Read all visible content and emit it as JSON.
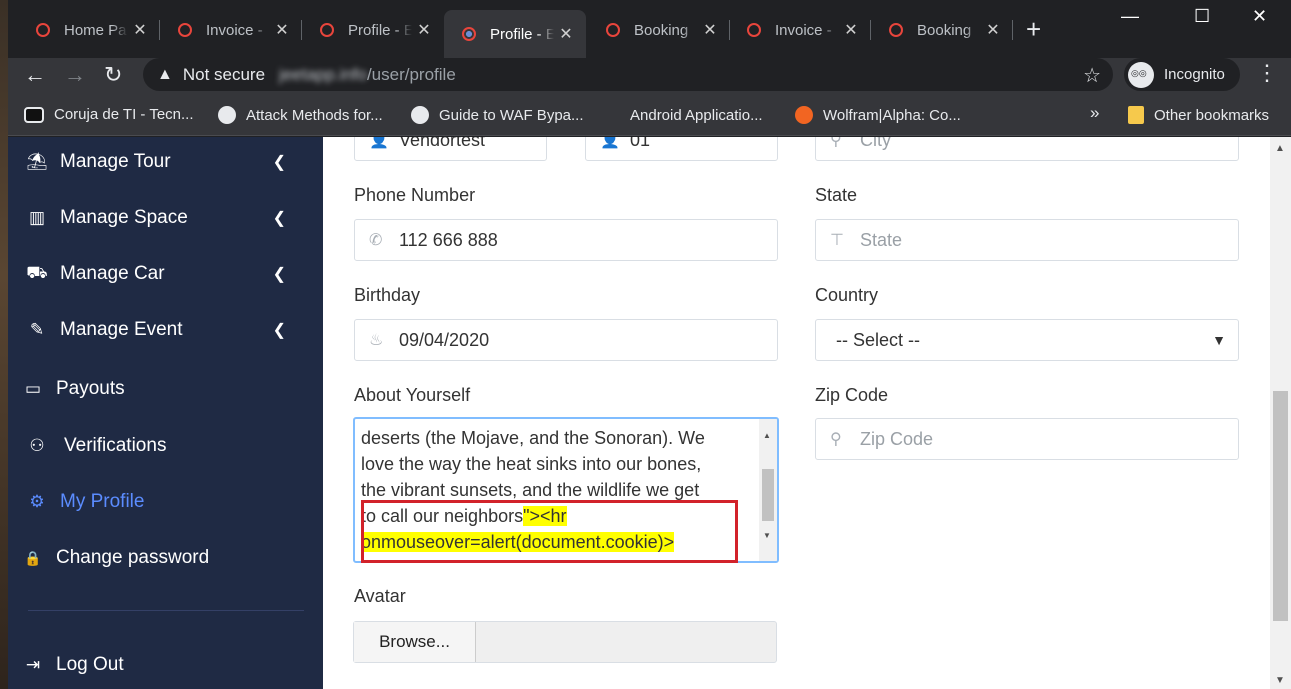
{
  "browser": {
    "tabs": [
      {
        "title": "Home Pa",
        "active": false
      },
      {
        "title": "Invoice -",
        "active": false
      },
      {
        "title": "Profile - E",
        "active": false
      },
      {
        "title": "Profile - E",
        "active": true
      },
      {
        "title": "Booking",
        "active": false
      },
      {
        "title": "Invoice -",
        "active": false
      },
      {
        "title": "Booking",
        "active": false
      }
    ],
    "new_tab": "+",
    "window_controls": {
      "minimize": "—",
      "maximize": "☐",
      "close": "✕"
    },
    "nav": {
      "back": "←",
      "forward": "→",
      "reload": "↻"
    },
    "address": {
      "security_label": "Not secure",
      "host": "jeetapp.info",
      "path": "/user/profile"
    },
    "incognito_label": "Incognito",
    "bookmarks": [
      {
        "label": "Coruja de TI - Tecn...",
        "icon": "owl-icon",
        "color": "#e8eaed"
      },
      {
        "label": "Attack Methods for...",
        "icon": "globe-icon",
        "color": "#e8eaed"
      },
      {
        "label": "Guide to WAF Bypa...",
        "icon": "globe-icon",
        "color": "#e8eaed"
      },
      {
        "label": "Android Applicatio...",
        "icon": "blank-icon",
        "color": "#35363a"
      },
      {
        "label": "Wolfram|Alpha: Co...",
        "icon": "wolfram-icon",
        "color": "#f26522"
      }
    ],
    "bookmarks_more": "»",
    "other_bookmarks": "Other bookmarks"
  },
  "sidebar": {
    "items": [
      {
        "label": "Manage Tour",
        "icon": "palm-tree-icon",
        "glyph": "⛱",
        "has_chevron": true,
        "active": false
      },
      {
        "label": "Manage Space",
        "icon": "building-icon",
        "glyph": "▥",
        "has_chevron": true,
        "active": false
      },
      {
        "label": "Manage Car",
        "icon": "car-icon",
        "glyph": "⛟",
        "has_chevron": true,
        "active": false
      },
      {
        "label": "Manage Event",
        "icon": "ticket-icon",
        "glyph": "✎",
        "has_chevron": true,
        "active": false
      },
      {
        "label": "Payouts",
        "icon": "credit-card-icon",
        "glyph": "▭",
        "has_chevron": false,
        "active": false
      },
      {
        "label": "Verifications",
        "icon": "handshake-icon",
        "glyph": "⚇",
        "has_chevron": false,
        "active": false
      },
      {
        "label": "My Profile",
        "icon": "cogs-icon",
        "glyph": "⚙",
        "has_chevron": false,
        "active": true
      },
      {
        "label": "Change password",
        "icon": "lock-icon",
        "glyph": "🔒",
        "has_chevron": false,
        "active": false
      }
    ],
    "logout": {
      "label": "Log Out",
      "icon": "logout-icon",
      "glyph": "⇥"
    },
    "active_color": "#5b8cff"
  },
  "form": {
    "top_partial": {
      "first_value": "Vendortest",
      "second_value": "01",
      "city_placeholder": "City"
    },
    "phone": {
      "label": "Phone Number",
      "value": "112 666 888"
    },
    "state": {
      "label": "State",
      "placeholder": "State"
    },
    "birthday": {
      "label": "Birthday",
      "value": "09/04/2020"
    },
    "country": {
      "label": "Country",
      "selected": "-- Select --"
    },
    "about": {
      "label": "About Yourself",
      "lines": [
        "deserts (the Mojave, and the Sonoran). We",
        "love the way the heat sinks into our bones,",
        "the vibrant sunsets, and the wildlife we get",
        "to call our neighbors",
        "\"><hr",
        "onmouseover=alert(document.cookie)>"
      ]
    },
    "zip": {
      "label": "Zip Code",
      "placeholder": "Zip Code"
    },
    "avatar": {
      "label": "Avatar",
      "button": "Browse..."
    }
  },
  "highlight_color": "#ffff00",
  "annotation_box_color": "#d2222a"
}
